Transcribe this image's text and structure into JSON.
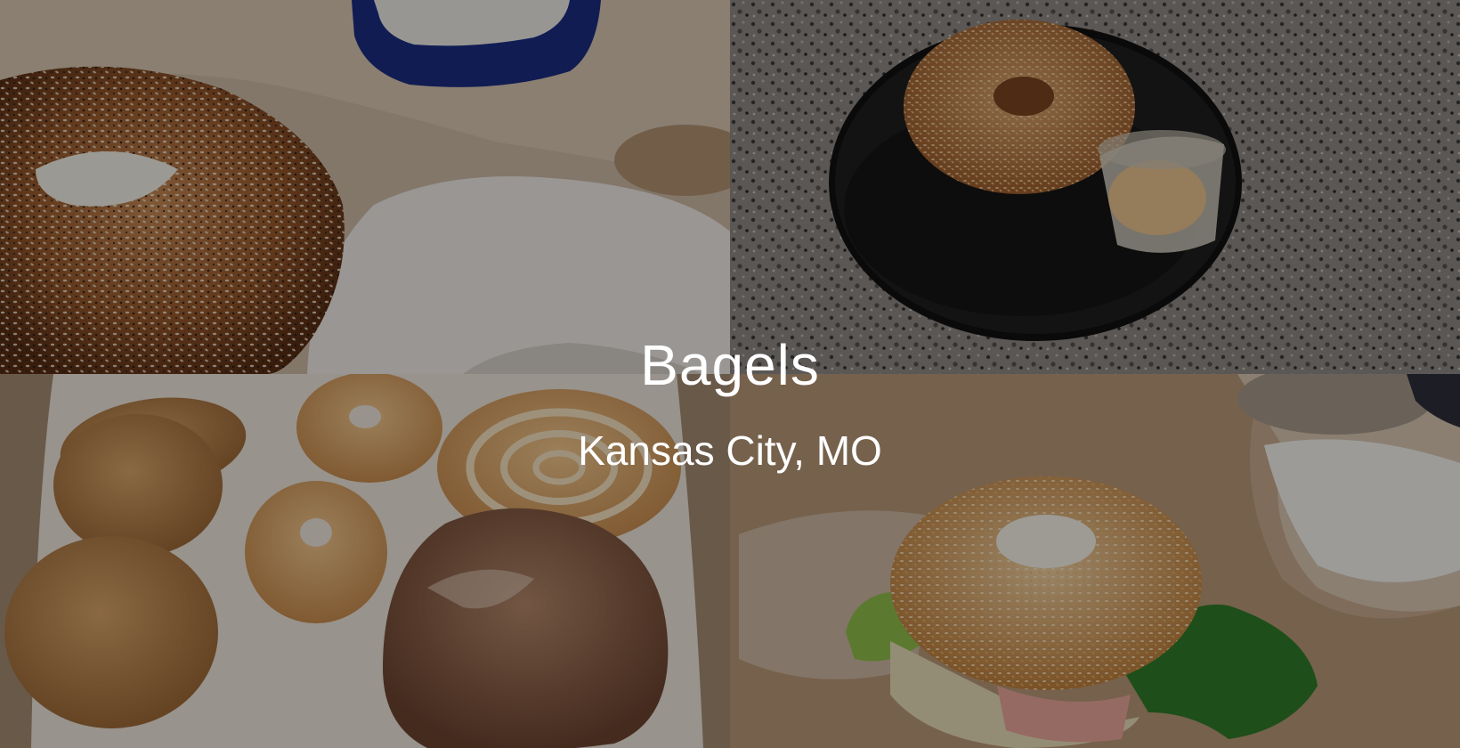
{
  "hero": {
    "title": "Bagels",
    "subtitle": "Kansas City, MO",
    "overlay_color": "#000000",
    "text_color": "#ffffff"
  },
  "photos": [
    {
      "id": "everything-bagel-cream-cheese"
    },
    {
      "id": "sesame-bagel-plate-spread"
    },
    {
      "id": "cookies-donuts-box"
    },
    {
      "id": "sesame-bagel-sandwich"
    }
  ]
}
